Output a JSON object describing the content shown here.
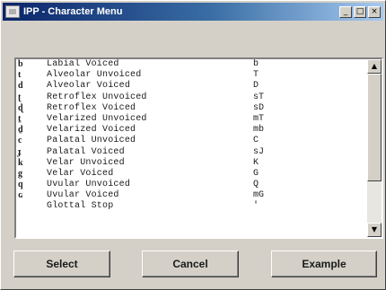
{
  "window": {
    "title": "IPP - Character Menu",
    "controls": {
      "minimize": "_",
      "maximize": "□",
      "close": "×"
    }
  },
  "list": {
    "rows": [
      {
        "glyph": "b",
        "name": "Labial Voiced",
        "code": "b"
      },
      {
        "glyph": "t",
        "name": "Alveolar Unvoiced",
        "code": "T"
      },
      {
        "glyph": "d",
        "name": "Alveolar Voiced",
        "code": "D"
      },
      {
        "glyph": "ʈ",
        "name": "Retroflex Unvoiced",
        "code": "sT"
      },
      {
        "glyph": "ɖ",
        "name": "Retroflex Voiced",
        "code": "sD"
      },
      {
        "glyph": "ṯ",
        "name": "Velarized Unvoiced",
        "code": "mT"
      },
      {
        "glyph": "ḏ",
        "name": "Velarized Voiced",
        "code": "mb"
      },
      {
        "glyph": "c",
        "name": "Palatal Unvoiced",
        "code": "C"
      },
      {
        "glyph": "ɟ",
        "name": "Palatal Voiced",
        "code": "sJ"
      },
      {
        "glyph": "k",
        "name": "Velar Unvoiced",
        "code": "K"
      },
      {
        "glyph": "g",
        "name": "Velar Voiced",
        "code": "G"
      },
      {
        "glyph": "q",
        "name": "Uvular Unvoiced",
        "code": "Q"
      },
      {
        "glyph": "ɢ",
        "name": "Uvular Voiced",
        "code": "mG"
      },
      {
        "glyph": "",
        "name": "Glottal Stop",
        "code": "'"
      }
    ],
    "scroll": {
      "up": "▲",
      "down": "▼"
    }
  },
  "buttons": {
    "select": "Select",
    "cancel": "Cancel",
    "example": "Example"
  }
}
